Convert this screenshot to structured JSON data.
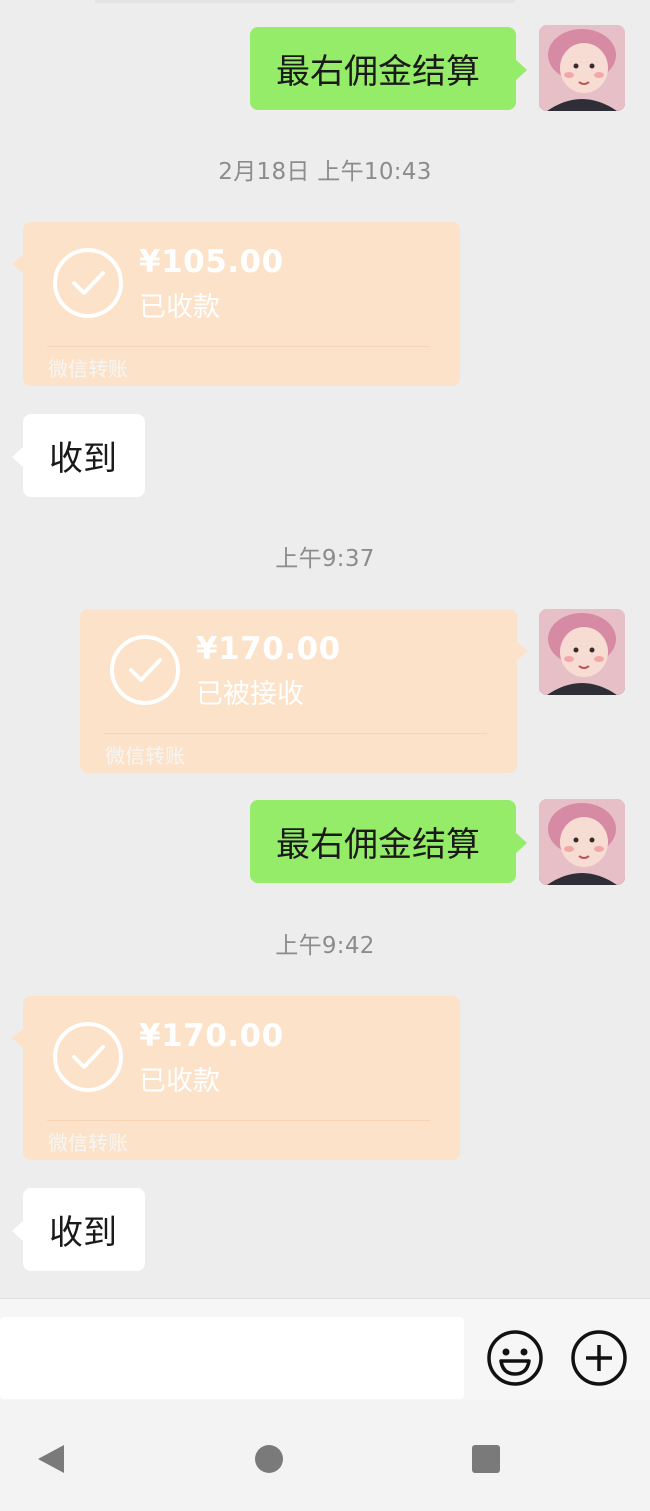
{
  "messages": {
    "m1": {
      "text": "最右佣金结算"
    },
    "t1": {
      "text": "2月18日 上午10:43"
    },
    "tr1": {
      "amount": "¥105.00",
      "status": "已收款",
      "label": "微信转账"
    },
    "r1": {
      "text": "收到"
    },
    "t2": {
      "text": "上午9:37"
    },
    "tr2": {
      "amount": "¥170.00",
      "status": "已被接收",
      "label": "微信转账"
    },
    "m2": {
      "text": "最右佣金结算"
    },
    "t3": {
      "text": "上午9:42"
    },
    "tr3": {
      "amount": "¥170.00",
      "status": "已收款",
      "label": "微信转账"
    },
    "r2": {
      "text": "收到"
    }
  },
  "input": {
    "placeholder": ""
  },
  "icons": {
    "emoji": "emoji-icon",
    "plus": "plus-icon",
    "nav_back": "nav-back-icon",
    "nav_home": "nav-home-icon",
    "nav_recent": "nav-recent-icon"
  },
  "colors": {
    "chat_bg": "#ededed",
    "sent_bubble": "#95ec69",
    "received_bubble": "#ffffff",
    "transfer_card": "#fbe2c8"
  }
}
